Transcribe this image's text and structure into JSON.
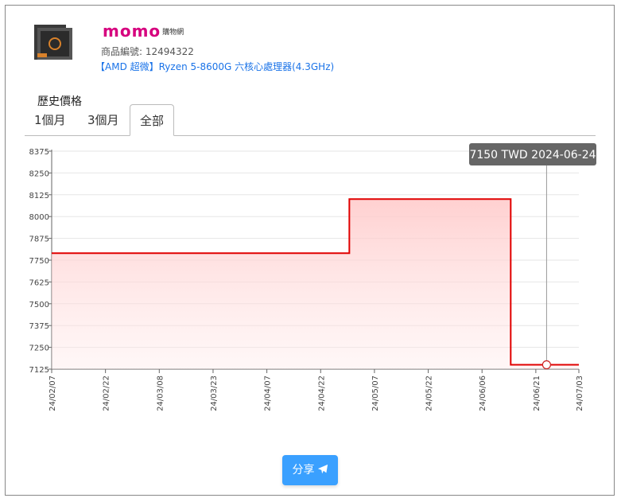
{
  "product": {
    "store_logo": "momo",
    "store_logo_sub": "購物網",
    "id_label": "商品編號: 12494322",
    "name": "【AMD 超微】Ryzen 5-8600G 六核心處理器(4.3GHz)"
  },
  "section_title": "歷史價格",
  "tabs": [
    {
      "label": "1個月"
    },
    {
      "label": "3個月"
    },
    {
      "label": "全部",
      "active": true
    }
  ],
  "share_label": "分享",
  "chart_data": {
    "type": "line",
    "line_shape": "step",
    "y_ticks": [
      7125,
      7250,
      7375,
      7500,
      7625,
      7750,
      7875,
      8000,
      8125,
      8250,
      8375
    ],
    "ylim": [
      7125,
      8375
    ],
    "x_ticks": [
      "24/02/07",
      "24/02/22",
      "24/03/08",
      "24/03/23",
      "24/04/07",
      "24/04/22",
      "24/05/07",
      "24/05/22",
      "24/06/06",
      "24/06/21",
      "24/07/03"
    ],
    "series": [
      {
        "points": [
          {
            "x": "2024-02-07",
            "y": 7790
          },
          {
            "x": "2024-04-30",
            "y": 7790
          },
          {
            "x": "2024-04-30",
            "y": 8100
          },
          {
            "x": "2024-06-14",
            "y": 8100
          },
          {
            "x": "2024-06-14",
            "y": 7150
          },
          {
            "x": "2024-07-03",
            "y": 7150
          }
        ],
        "color": "#e00000",
        "fill": "#ffcccc"
      }
    ],
    "tooltip": {
      "text": "7150 TWD 2024-06-24",
      "x": "2024-06-24",
      "y": 7150
    },
    "grid": true
  }
}
